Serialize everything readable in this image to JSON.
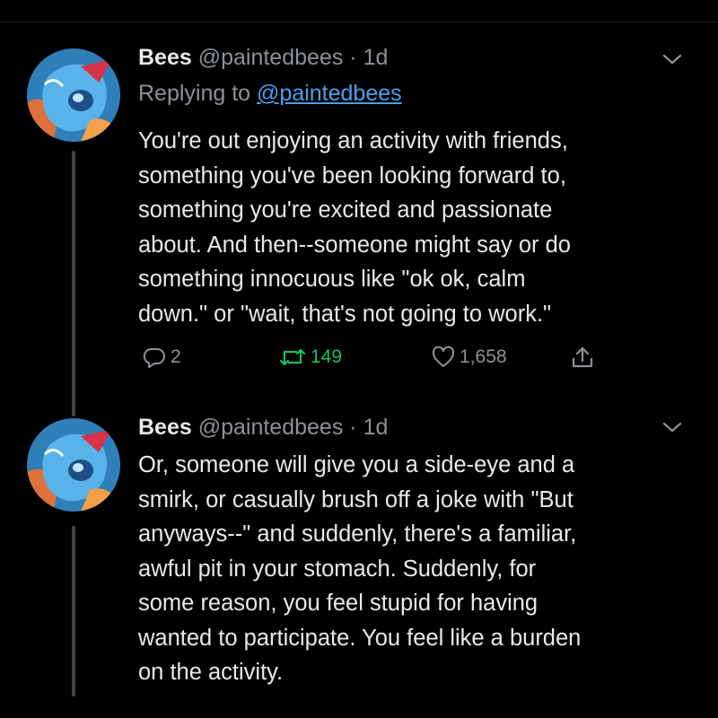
{
  "tweets": [
    {
      "name": "Bees",
      "handle": "@paintedbees",
      "separator": "·",
      "time": "1d",
      "replying_prefix": "Replying to",
      "replying_handle": "@paintedbees",
      "lines": [
        "You're out enjoying an activity with friends,",
        "something you've been looking forward to,",
        "something you're excited and passionate",
        "about. And then--someone might say or do",
        "something innocuous like \"ok ok, calm",
        "down.\" or \"wait, that's not going to work.\""
      ],
      "replies": "2",
      "retweets": "149",
      "likes": "1,658"
    },
    {
      "name": "Bees",
      "handle": "@paintedbees",
      "separator": "·",
      "time": "1d",
      "lines": [
        "Or, someone will give you a side-eye and a",
        "smirk, or casually brush off a joke with \"But",
        "anyways--\" and suddenly, there's a familiar,",
        "awful pit in your stomach. Suddenly, for",
        "some reason, you feel stupid for having",
        "wanted to participate. You feel like a burden",
        "on the activity."
      ]
    }
  ],
  "icons": {
    "reply": "speech-bubble-icon",
    "retweet": "retweet-arrows-icon",
    "like": "heart-icon",
    "share": "share-upload-icon",
    "more": "chevron-down-icon"
  },
  "colors": {
    "background": "#000000",
    "text": "#e7e9ea",
    "muted": "#8b9298",
    "link": "#4c9eeb",
    "retweet_active": "#17bf63",
    "thread_line": "#3d4247"
  }
}
